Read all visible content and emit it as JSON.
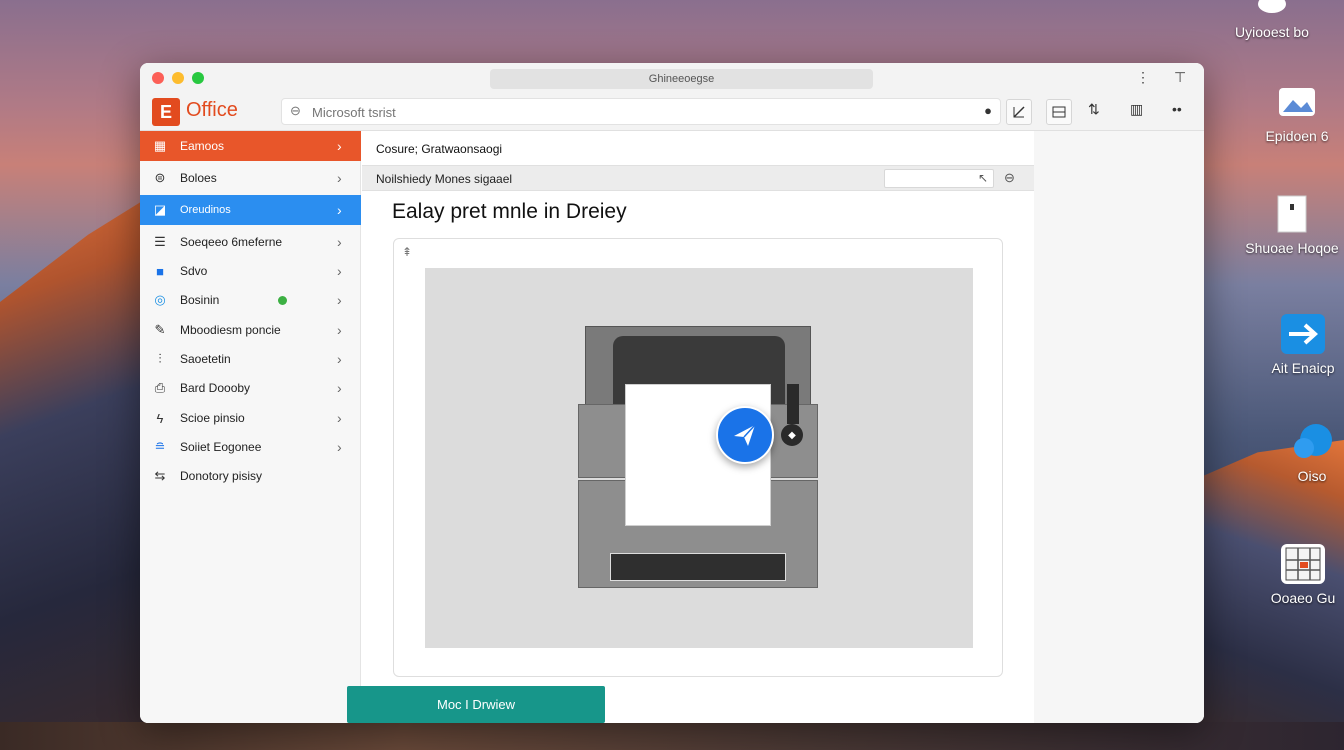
{
  "desktop": {
    "icons": [
      {
        "label": "Uyiooest bo",
        "icon": "cloud-icon"
      },
      {
        "label": "Epidoen 6",
        "icon": "image-icon"
      },
      {
        "label": "Shuoae Hoqoe",
        "icon": "document-icon"
      },
      {
        "label": "Ait Enaicp",
        "icon": "arrow-icon"
      },
      {
        "label": "Oiso",
        "icon": "chat-icon"
      },
      {
        "label": "Ooaeo Gu",
        "icon": "grid-icon"
      }
    ]
  },
  "window": {
    "title": "Ghineeoegse",
    "toolbar": {
      "logo_letter": "E",
      "logo_text": "Office",
      "search_placeholder": "Microsoft tsrist"
    }
  },
  "sidebar": {
    "items": [
      {
        "label": "Eamoos",
        "icon": "grid-icon",
        "style": "orange"
      },
      {
        "label": "Boloes",
        "icon": "database-icon",
        "style": "normal"
      },
      {
        "label": "Oreudinos",
        "icon": "inbox-icon",
        "style": "blue"
      },
      {
        "label": "Soeqeeo 6meferne",
        "icon": "list-icon",
        "style": "normal"
      },
      {
        "label": "Sdvo",
        "icon": "folder-icon",
        "style": "normal"
      },
      {
        "label": "Bosinin",
        "icon": "circle-icon",
        "style": "normal",
        "badge": true
      },
      {
        "label": "Mboodiesm poncie",
        "icon": "pen-icon",
        "style": "normal"
      },
      {
        "label": "Saoetetin",
        "icon": "sliders-icon",
        "style": "normal"
      },
      {
        "label": "Bard Doooby",
        "icon": "printer-icon",
        "style": "normal"
      },
      {
        "label": "Scioe pinsio",
        "icon": "bolt-icon",
        "style": "normal"
      },
      {
        "label": "Soiiet Eogonee",
        "icon": "stack-icon",
        "style": "normal"
      },
      {
        "label": "Donotory pisisy",
        "icon": "link-icon",
        "style": "normal",
        "no_chevron": true
      }
    ]
  },
  "main": {
    "breadcrumb": "Cosure; Gratwaonsaogi",
    "filter_label": "Noilshiedy Mones sigaael",
    "heading": "Ealay pret mnle in Dreiey",
    "cta_label": "Moc I Drwiew"
  },
  "colors": {
    "office_orange": "#e24b1f",
    "sidebar_orange": "#e8562a",
    "sidebar_blue": "#2b8ef0",
    "send_blue": "#1a73e8",
    "cta_teal": "#17968a"
  }
}
